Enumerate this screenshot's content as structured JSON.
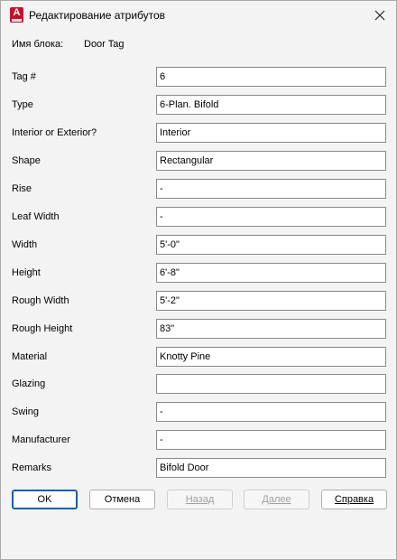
{
  "window": {
    "title": "Редактирование атрибутов",
    "icon": "autocad-icon"
  },
  "block": {
    "label": "Имя блока:",
    "name": "Door Tag"
  },
  "attributes": [
    {
      "label": "Tag #",
      "value": "6"
    },
    {
      "label": "Type",
      "value": "6-Plan. Bifold"
    },
    {
      "label": "Interior or Exterior?",
      "value": "Interior"
    },
    {
      "label": "Shape",
      "value": "Rectangular"
    },
    {
      "label": "Rise",
      "value": "-"
    },
    {
      "label": "Leaf Width",
      "value": "-"
    },
    {
      "label": "Width",
      "value": "5'-0\""
    },
    {
      "label": "Height",
      "value": "6'-8\""
    },
    {
      "label": "Rough Width",
      "value": "5'-2\""
    },
    {
      "label": "Rough Height",
      "value": "83\""
    },
    {
      "label": "Material",
      "value": "Knotty Pine"
    },
    {
      "label": "Glazing",
      "value": ""
    },
    {
      "label": "Swing",
      "value": "-"
    },
    {
      "label": "Manufacturer",
      "value": "-"
    },
    {
      "label": "Remarks",
      "value": "Bifold Door"
    }
  ],
  "buttons": {
    "ok": "OK",
    "cancel": "Отмена",
    "back": "Назад",
    "next": "Далее",
    "help": "Справка"
  },
  "colors": {
    "accent": "#005fb8",
    "icon": "#c8102e"
  }
}
